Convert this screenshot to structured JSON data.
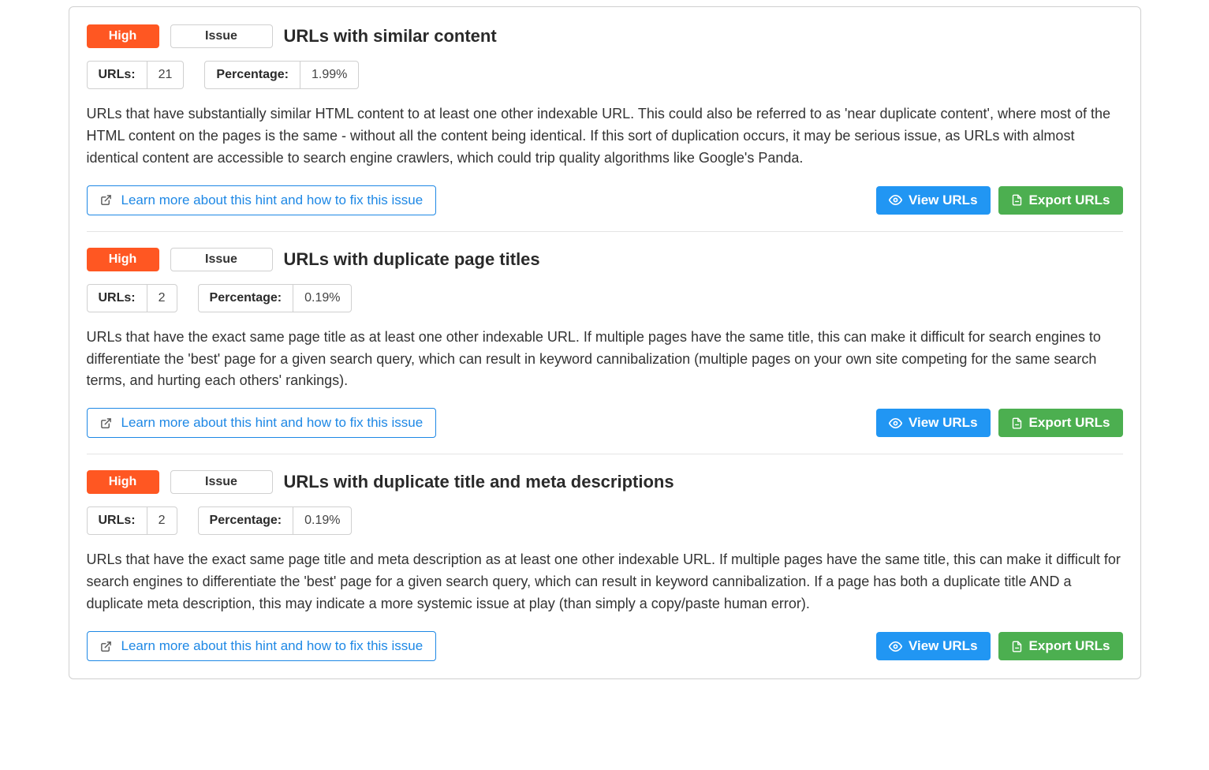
{
  "labels": {
    "severity_high": "High",
    "type_issue": "Issue",
    "urls_label": "URLs:",
    "percentage_label": "Percentage:",
    "learn_more": "Learn more about this hint and how to fix this issue",
    "view_urls": "View URLs",
    "export_urls": "Export URLs"
  },
  "issues": [
    {
      "title": "URLs with similar content",
      "urls_count": "21",
      "percentage": "1.99%",
      "description": "URLs that have substantially similar HTML content to at least one other indexable URL. This could also be referred to as 'near duplicate content', where most of the HTML content on the pages is the same - without all the content being identical. If this sort of duplication occurs, it may be serious issue, as URLs with almost identical content are accessible to search engine crawlers, which could trip quality algorithms like Google's Panda."
    },
    {
      "title": "URLs with duplicate page titles",
      "urls_count": "2",
      "percentage": "0.19%",
      "description": "URLs that have the exact same page title as at least one other indexable URL. If multiple pages have the same title, this can make it difficult for search engines to differentiate the 'best' page for a given search query, which can result in keyword cannibalization (multiple pages on your own site competing for the same search terms, and hurting each others' rankings)."
    },
    {
      "title": "URLs with duplicate title and meta descriptions",
      "urls_count": "2",
      "percentage": "0.19%",
      "description": "URLs that have the exact same page title and meta description as at least one other indexable URL. If multiple pages have the same title, this can make it difficult for search engines to differentiate the 'best' page for a given search query, which can result in keyword cannibalization. If a page has both a duplicate title AND a duplicate meta description, this may indicate a more systemic issue at play (than simply a copy/paste human error)."
    }
  ]
}
